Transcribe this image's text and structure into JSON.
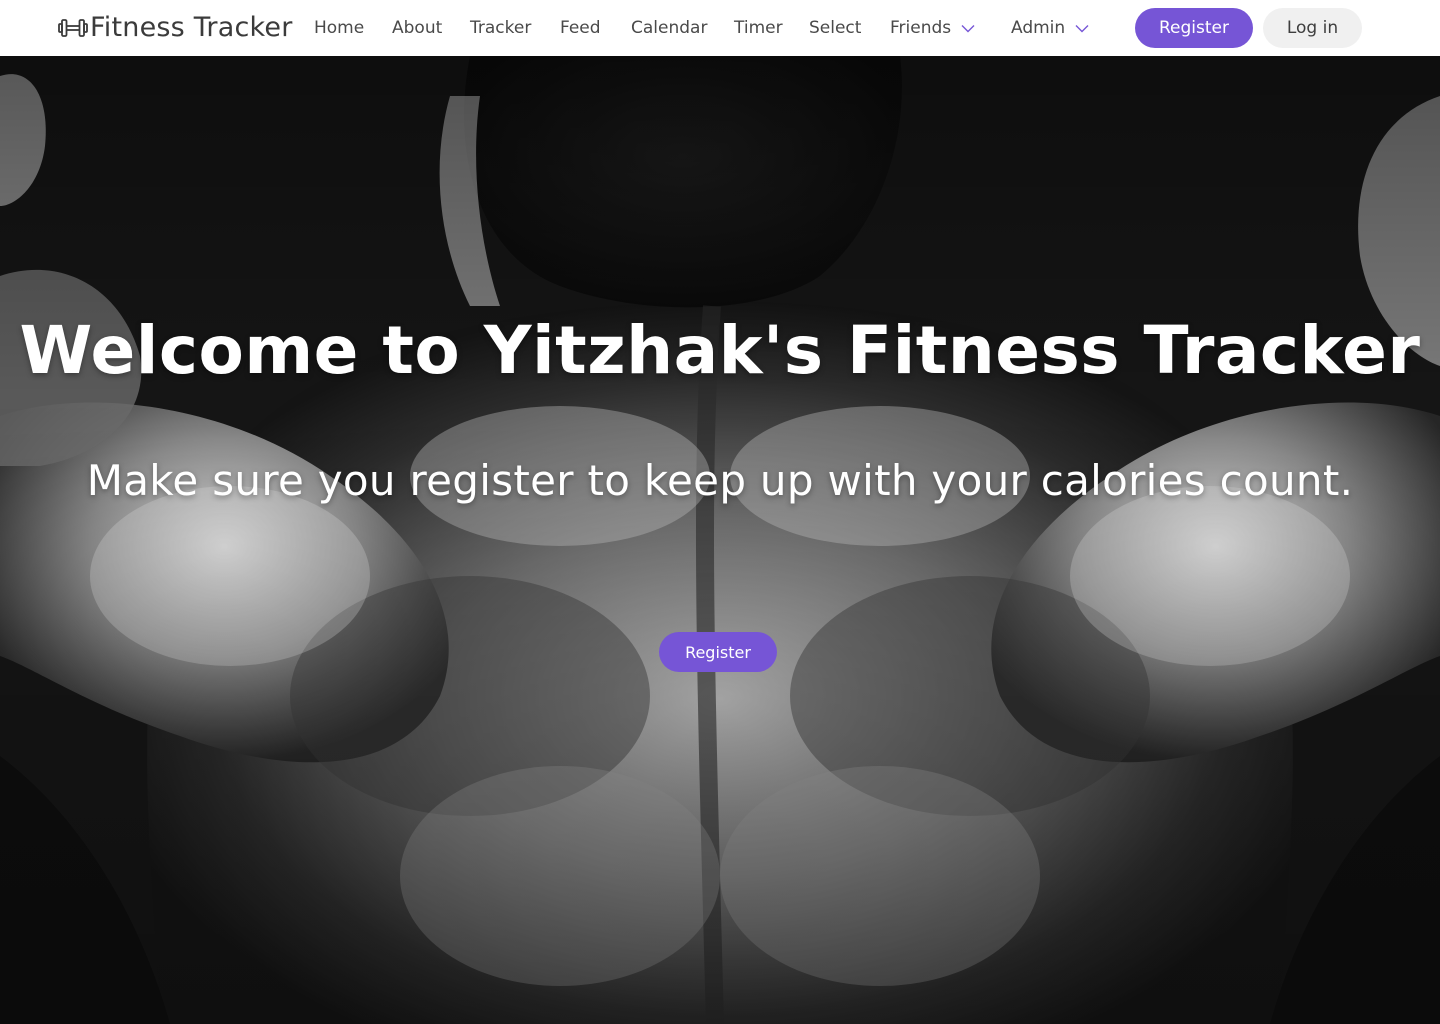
{
  "navbar": {
    "brand": {
      "icon": "dumbbell-icon",
      "title": "Fitness Tracker"
    },
    "links": [
      {
        "label": "Home"
      },
      {
        "label": "About"
      },
      {
        "label": "Tracker"
      },
      {
        "label": "Feed"
      },
      {
        "label": "Calendar"
      },
      {
        "label": "Timer"
      },
      {
        "label": "Select"
      },
      {
        "label": "Friends",
        "icon": "chevron-down-icon"
      },
      {
        "label": "Admin",
        "icon": "chevron-down-icon"
      }
    ],
    "register_label": "Register",
    "login_label": "Log in"
  },
  "hero": {
    "background": "black-and-white photo of a bodybuilder's back",
    "title": "Welcome to Yitzhak's Fitness Tracker",
    "subtitle": "Make sure you register to keep up with your calories count.",
    "register_label": "Register"
  },
  "colors": {
    "accent": "#7655d6",
    "navbar_bg": "#ffffff",
    "login_bg": "#f0f0f0",
    "nav_text": "#4a4a4a"
  }
}
